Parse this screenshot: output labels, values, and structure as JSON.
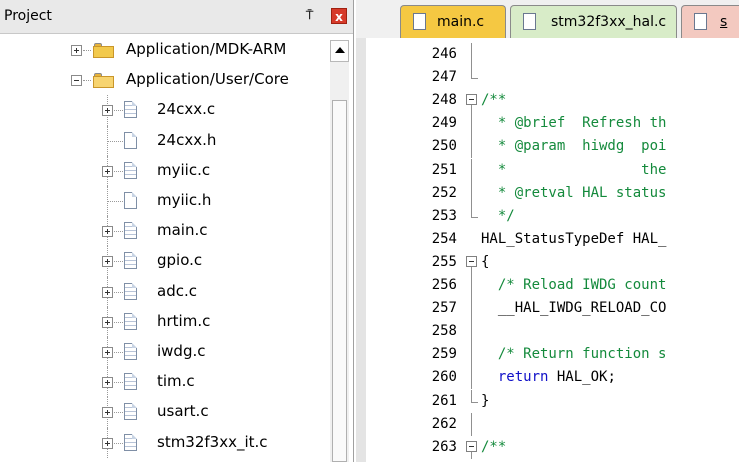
{
  "project_panel": {
    "title": "Project",
    "pin_glyph": "⍑",
    "close_glyph": "x",
    "tree": [
      {
        "label": "Application/MDK-ARM",
        "kind": "folder",
        "state": "collapsed"
      },
      {
        "label": "Application/User/Core",
        "kind": "folder",
        "state": "expanded"
      },
      {
        "label": "24cxx.c",
        "kind": "file",
        "expander": true
      },
      {
        "label": "24cxx.h",
        "kind": "file",
        "expander": false
      },
      {
        "label": "myiic.c",
        "kind": "file",
        "expander": true
      },
      {
        "label": "myiic.h",
        "kind": "file",
        "expander": false
      },
      {
        "label": "main.c",
        "kind": "file",
        "expander": true
      },
      {
        "label": "gpio.c",
        "kind": "file",
        "expander": true
      },
      {
        "label": "adc.c",
        "kind": "file",
        "expander": true
      },
      {
        "label": "hrtim.c",
        "kind": "file",
        "expander": true
      },
      {
        "label": "iwdg.c",
        "kind": "file",
        "expander": true
      },
      {
        "label": "tim.c",
        "kind": "file",
        "expander": true
      },
      {
        "label": "usart.c",
        "kind": "file",
        "expander": true
      },
      {
        "label": "stm32f3xx_it.c",
        "kind": "file",
        "expander": true
      }
    ]
  },
  "editor": {
    "tabs": [
      {
        "label": "main.c",
        "state": "active"
      },
      {
        "label": "stm32f3xx_hal.c",
        "state": "inactive"
      },
      {
        "label": "s",
        "state": "partial"
      }
    ],
    "lines": [
      {
        "no": "246",
        "text": "",
        "style": "plain",
        "fold": "line"
      },
      {
        "no": "247",
        "text": "",
        "style": "plain",
        "fold": "end"
      },
      {
        "no": "248",
        "text": "/**",
        "style": "comment",
        "fold": "box"
      },
      {
        "no": "249",
        "text": "  * @brief  Refresh th",
        "style": "comment",
        "fold": "line"
      },
      {
        "no": "250",
        "text": "  * @param  hiwdg  poi",
        "style": "comment",
        "fold": "line"
      },
      {
        "no": "251",
        "text": "  *                the",
        "style": "comment",
        "fold": "line"
      },
      {
        "no": "252",
        "text": "  * @retval HAL status",
        "style": "comment",
        "fold": "line"
      },
      {
        "no": "253",
        "text": "  */",
        "style": "comment",
        "fold": "end"
      },
      {
        "no": "254",
        "text": "HAL_StatusTypeDef HAL_",
        "style": "plain",
        "fold": "none"
      },
      {
        "no": "255",
        "text": "{",
        "style": "plain",
        "fold": "box"
      },
      {
        "no": "256",
        "text": "  /* Reload IWDG count",
        "style": "comment",
        "fold": "line"
      },
      {
        "no": "257",
        "text": "  __HAL_IWDG_RELOAD_CO",
        "style": "plain",
        "fold": "line"
      },
      {
        "no": "258",
        "text": "",
        "style": "plain",
        "fold": "line"
      },
      {
        "no": "259",
        "text": "  /* Return function s",
        "style": "comment",
        "fold": "line"
      },
      {
        "no": "260",
        "text": "  return HAL_OK;",
        "style": "keyword-return",
        "fold": "line"
      },
      {
        "no": "261",
        "text": "}",
        "style": "plain",
        "fold": "end"
      },
      {
        "no": "262",
        "text": "",
        "style": "plain",
        "fold": "line"
      },
      {
        "no": "263",
        "text": "/**",
        "style": "comment",
        "fold": "box"
      }
    ]
  }
}
